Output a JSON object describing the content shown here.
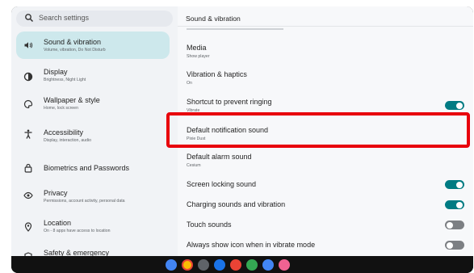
{
  "search": {
    "placeholder": "Search settings",
    "icon": "search-icon"
  },
  "nav": [
    {
      "title": "Sound & vibration",
      "subtitle": "Volume, vibration, Do Not Disturb",
      "icon": "speaker-icon",
      "selected": true
    },
    {
      "title": "Display",
      "subtitle": "Brightness, Night Light",
      "icon": "brightness-icon"
    },
    {
      "title": "Wallpaper & style",
      "subtitle": "Home, lock screen",
      "icon": "palette-icon"
    },
    {
      "title": "Accessibility",
      "subtitle": "Display, interaction, audio",
      "icon": "accessibility-icon"
    },
    {
      "title": "Biometrics and Passwords",
      "subtitle": "",
      "icon": "lock-icon"
    },
    {
      "title": "Privacy",
      "subtitle": "Permissions, account activity, personal data",
      "icon": "privacy-eye-icon"
    },
    {
      "title": "Location",
      "subtitle": "On - 8 apps have access to location",
      "icon": "location-pin-icon"
    },
    {
      "title": "Safety & emergency",
      "subtitle": "",
      "icon": "safety-icon"
    }
  ],
  "panel": {
    "title": "Sound & vibration",
    "rows": [
      {
        "title": "Media",
        "subtitle": "Show player"
      },
      {
        "title": "Vibration & haptics",
        "subtitle": "On"
      },
      {
        "title": "Shortcut to prevent ringing",
        "subtitle": "Vibrate",
        "toggle": "on"
      },
      {
        "title": "Default notification sound",
        "subtitle": "Pixie Dust",
        "highlighted": true
      },
      {
        "title": "Default alarm sound",
        "subtitle": "Cesium"
      },
      {
        "title": "Screen locking sound",
        "toggle": "on"
      },
      {
        "title": "Charging sounds and vibration",
        "toggle": "on"
      },
      {
        "title": "Touch sounds",
        "toggle": "off"
      },
      {
        "title": "Always show icon when in vibrate mode",
        "toggle": "off"
      }
    ]
  },
  "colors": {
    "accent": "#007b83",
    "selected_bg": "#cde8ec",
    "highlight_border": "#e8000b",
    "toggle_off": "#7c7f83"
  },
  "dock_apps": [
    {
      "name": "launcher-icon",
      "color": "#4285f4"
    },
    {
      "name": "chrome-icon",
      "color": "#fbbc04"
    },
    {
      "name": "camera-icon",
      "color": "#5f6368"
    },
    {
      "name": "settings-app-icon",
      "color": "#1a73e8"
    },
    {
      "name": "play-store-icon",
      "color": "#ea4335"
    },
    {
      "name": "photos-icon",
      "color": "#34a853"
    },
    {
      "name": "files-icon",
      "color": "#4285f4"
    },
    {
      "name": "app-icon",
      "color": "#f06292"
    }
  ]
}
